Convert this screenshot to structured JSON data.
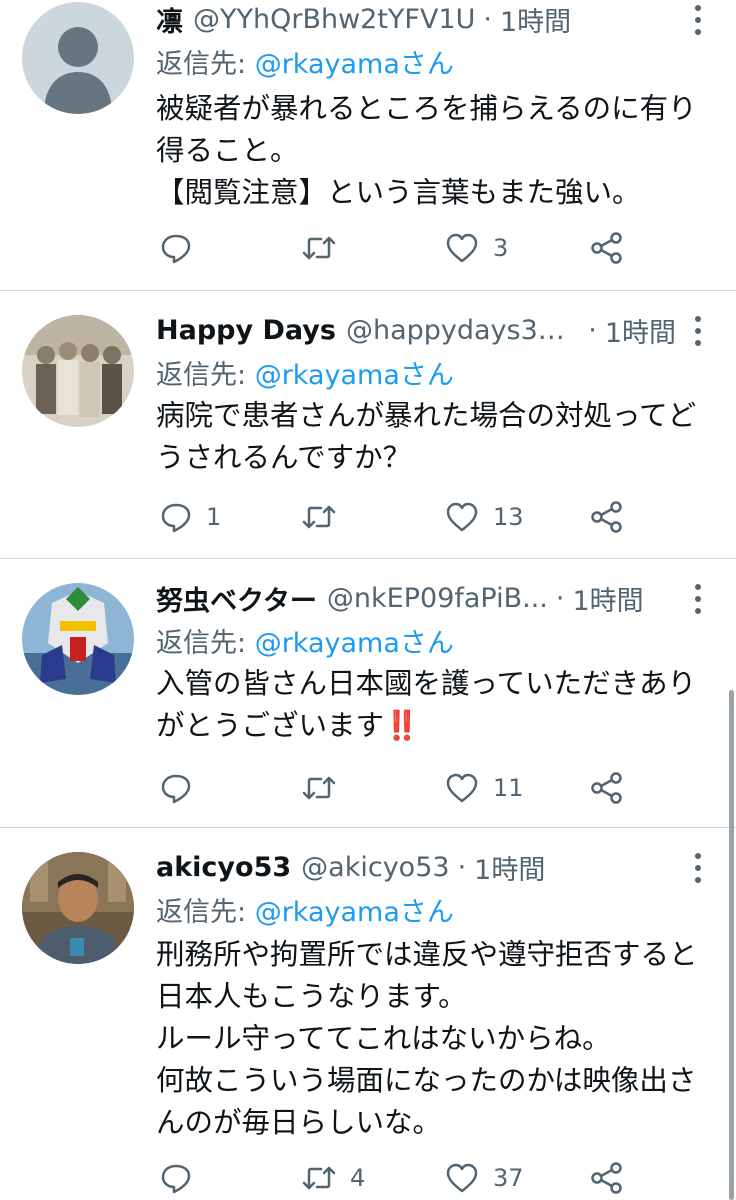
{
  "tweets": [
    {
      "name": "凛",
      "handle": "@YYhQrBhw2tYFV1U",
      "separator": "·",
      "time": "1時間",
      "reply_prefix": "返信先: ",
      "reply_to": "@rkayamaさん",
      "text": "被疑者が暴れるところを捕らえるのに有り得ること。\n【閲覧注意】という言葉もまた強い。",
      "reply_count": "",
      "retweet_count": "",
      "like_count": "3",
      "avatar": "default-avatar"
    },
    {
      "name": "Happy Days",
      "handle": "@happydays30...",
      "separator": "·",
      "time": "1時間",
      "reply_prefix": "返信先: ",
      "reply_to": "@rkayamaさん",
      "text": "病院で患者さんが暴れた場合の対処ってどうされるんですか？",
      "reply_count": "1",
      "retweet_count": "",
      "like_count": "13",
      "avatar": "vintage-photo-avatar"
    },
    {
      "name": "努虫ベクター",
      "handle": "@nkEP09faPiB...",
      "separator": "·",
      "time": "1時間",
      "reply_prefix": "返信先: ",
      "reply_to": "@rkayamaさん",
      "text": "入管の皆さん日本國を護っていただきありがとうございます",
      "text_suffix": "‼️",
      "reply_count": "",
      "retweet_count": "",
      "like_count": "11",
      "avatar": "robot-avatar"
    },
    {
      "name": "akicyo53",
      "handle": "@akicyo53",
      "separator": "·",
      "time": "1時間",
      "reply_prefix": "返信先: ",
      "reply_to": "@rkayamaさん",
      "text": "刑務所や拘置所では違反や遵守拒否すると日本人もこうなります。\nルール守っててこれはないからね。\n何故こういう場面になったのかは映像出さんのが毎日らしいな。",
      "reply_count": "",
      "retweet_count": "4",
      "like_count": "37",
      "avatar": "man-photo-avatar"
    }
  ],
  "icons": {
    "reply": "speech-bubble-icon",
    "retweet": "retweet-arrows-icon",
    "like": "heart-icon",
    "share": "share-nodes-icon",
    "more": "vertical-dots-icon"
  },
  "colors": {
    "text": "#0f1419",
    "secondary": "#536471",
    "link": "#1d9bf0",
    "divider": "#cfd9de",
    "emphasis": "#e0245e"
  }
}
